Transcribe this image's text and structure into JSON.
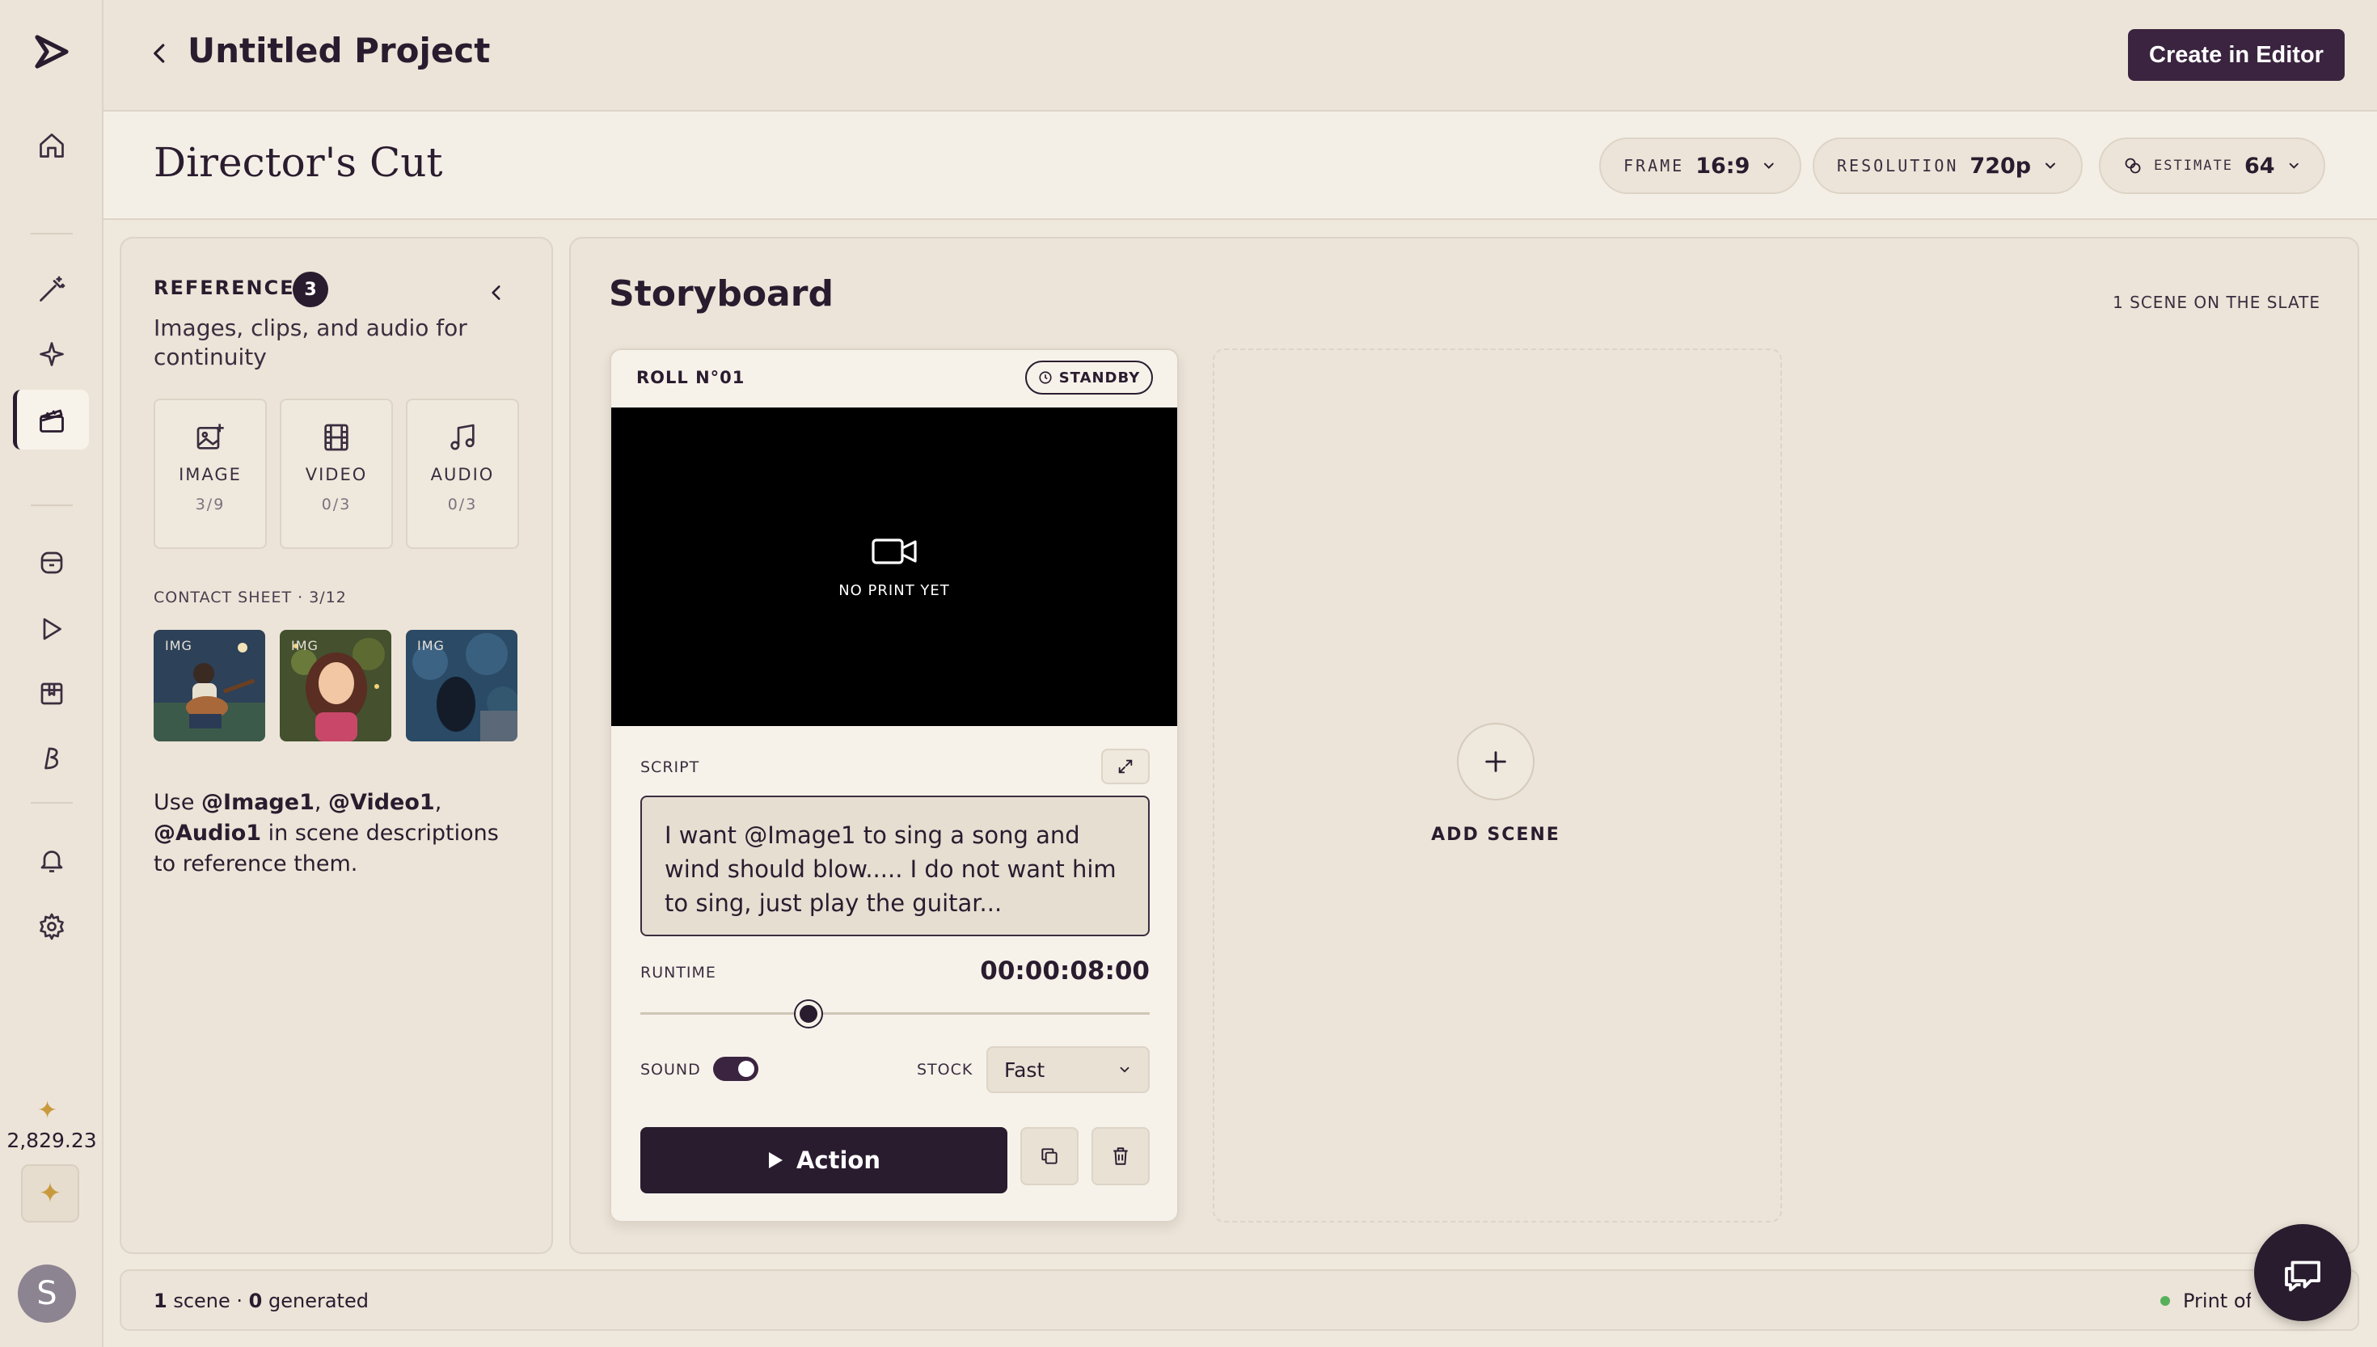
{
  "header": {
    "project_title": "Untitled Project",
    "create_label": "Create in Editor"
  },
  "subheader": {
    "title": "Director's Cut",
    "frame": {
      "label": "FRAME",
      "value": "16:9"
    },
    "resolution": {
      "label": "RESOLUTION",
      "value": "720p"
    },
    "estimate": {
      "label": "ESTIMATE",
      "value": "64"
    }
  },
  "rail": {
    "credits": "2,829.23",
    "avatar_initial": "S",
    "icons": [
      "logo-icon",
      "home-icon",
      "magic-wand-icon",
      "sparkle-icon",
      "clapperboard-icon",
      "archive-icon",
      "play-icon",
      "box-icon",
      "brush-icon",
      "bell-icon",
      "gear-icon"
    ]
  },
  "references": {
    "title": "REFERENCES",
    "count": "3",
    "description": "Images, clips, and audio for continuity",
    "tiles": [
      {
        "label": "IMAGE",
        "count": "3/9"
      },
      {
        "label": "VIDEO",
        "count": "0/3"
      },
      {
        "label": "AUDIO",
        "count": "0/3"
      }
    ],
    "contact_sheet": "CONTACT SHEET · 3/12",
    "thumb_tag": "IMG",
    "usage": {
      "prefix": "Use ",
      "tag1": "@Image1",
      "sep1": ", ",
      "tag2": "@Video1",
      "sep2": ", ",
      "tag3": "@Audio1",
      "suffix": " in scene descriptions to reference them."
    }
  },
  "storyboard": {
    "title": "Storyboard",
    "slate": "1 SCENE ON THE SLATE",
    "scene": {
      "roll": "ROLL N°01",
      "status": "STANDBY",
      "no_print": "NO PRINT YET",
      "script_label": "SCRIPT",
      "script_text": "I want @Image1 to sing a song and wind should blow..... I do not want him to sing, just play the guitar...",
      "runtime_label": "RUNTIME",
      "runtime_value": "00:00:08:00",
      "runtime_fraction": 0.33,
      "sound_label": "SOUND",
      "sound_on": true,
      "stock_label": "STOCK",
      "stock_value": "Fast",
      "action_label": "Action"
    },
    "add_scene": "ADD SCENE"
  },
  "footer": {
    "scenes_count": "1",
    "scenes_word": " scene · ",
    "generated_count": "0",
    "generated_word": " generated",
    "status": "Print of the"
  },
  "colors": {
    "accent": "#3b2440",
    "dark": "#2a1c2f",
    "background": "#efe8dd",
    "status_green": "#58b05c",
    "gold": "#c99a3d"
  }
}
